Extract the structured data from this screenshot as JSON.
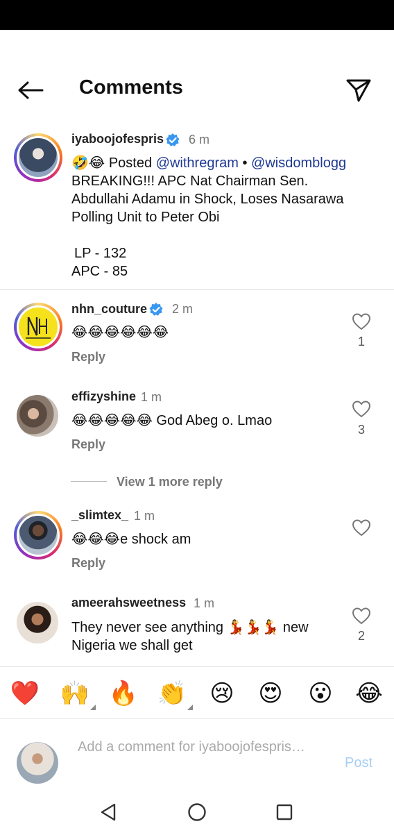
{
  "header": {
    "title": "Comments"
  },
  "post": {
    "username": "iyaboojofespris",
    "time": "6 m",
    "emojis": "🤣😂",
    "posted_prefix": "Posted",
    "mention1": "@withregram",
    "bullet": "•",
    "mention2": "@wisdomblogg",
    "text": "BREAKING!!! APC Nat Chairman Sen. Abdullahi Adamu in Shock, Loses Nasarawa Polling Unit to Peter Obi",
    "result1": "LP - 132",
    "result2": "APC - 85"
  },
  "comments": [
    {
      "username": "nhn_couture",
      "verified": true,
      "time": "2 m",
      "text": "😂😂😂😂😂😂",
      "reply": "Reply",
      "likes": "1"
    },
    {
      "username": "effizyshine",
      "verified": false,
      "time": "1 m",
      "text": "😂😂😂😂😂 God Abeg o. Lmao",
      "reply": "Reply",
      "likes": "3"
    },
    {
      "username": "_slimtex_",
      "verified": false,
      "time": "1 m",
      "text": "😂😂😂e shock am",
      "reply": "Reply",
      "likes": ""
    },
    {
      "username": "ameerahsweetness",
      "verified": false,
      "time": "1 m",
      "text": "They never see anything 💃💃💃 new Nigeria we shall get",
      "reply": "",
      "likes": "2"
    }
  ],
  "view_more": "View 1 more reply",
  "emoji_bar": [
    "❤️",
    "🙌",
    "🔥",
    "👏",
    "😢",
    "😍",
    "😮",
    "😂"
  ],
  "composer": {
    "placeholder": "Add a comment for iyaboojofespris…",
    "post_label": "Post"
  },
  "colors": {
    "verified": "#3897f0",
    "mention": "#1f3a93",
    "post_disabled": "#a7cff5"
  },
  "icons": {
    "back": "arrow-left-icon",
    "send": "paper-plane-icon",
    "heart": "heart-outline-icon",
    "nav_back": "triangle-back-icon",
    "nav_home": "circle-home-icon",
    "nav_recent": "square-recents-icon"
  }
}
